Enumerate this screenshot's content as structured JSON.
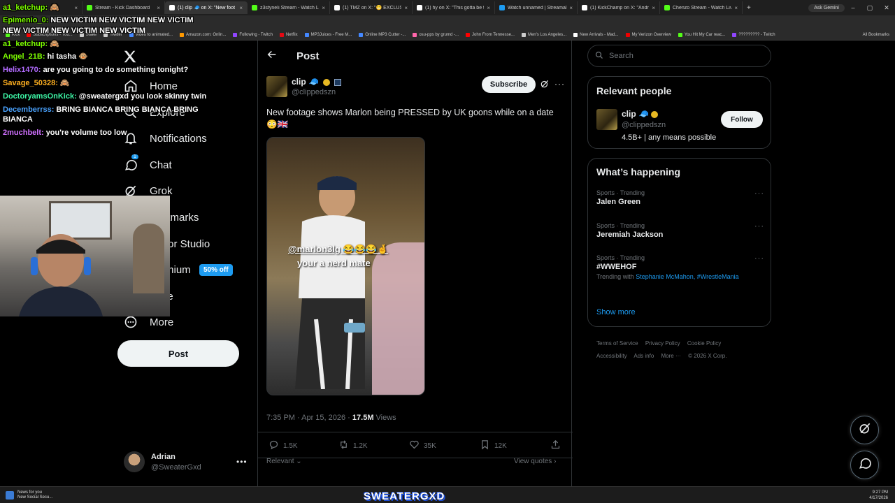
{
  "browser": {
    "tabs": [
      {
        "title": "",
        "color": "#a83232"
      },
      {
        "title": "Stream - Kick Dashboard",
        "color": "#53fc18"
      },
      {
        "title": "(1) clip 🧢 on X: \"New foot",
        "color": "#ffffff"
      },
      {
        "title": "z3styneIi Stream - Watch Live o",
        "color": "#53fc18"
      },
      {
        "title": "(1) TMZ on X: \"😬 EXCLUSIVE:",
        "color": "#ffffff"
      },
      {
        "title": "(1) hy on X: \"This gotta be the",
        "color": "#ffffff"
      },
      {
        "title": "Watch unnamed | Streamable",
        "color": "#1d9bf0"
      },
      {
        "title": "(1) KickChamp on X: \"Andr",
        "color": "#ffffff"
      },
      {
        "title": "Chenzo Stream - Watch Live on",
        "color": "#53fc18"
      }
    ],
    "active_tab": 2,
    "new_tab": "+",
    "ask_gemini": "Ask Gemini",
    "window_controls": [
      "–",
      "▢",
      "✕"
    ],
    "bookmarks": [
      {
        "label": "Kick",
        "color": "#53fc18"
      },
      {
        "label": "Subscriptions - You...",
        "color": "#ff0000"
      },
      {
        "label": "Stake",
        "color": "#cccccc"
      },
      {
        "label": "Twitter",
        "color": "#cccccc"
      },
      {
        "label": "Video to animated...",
        "color": "#4488ff"
      },
      {
        "label": "Amazon.com: Onlin...",
        "color": "#ff9900"
      },
      {
        "label": "Following - Twitch",
        "color": "#9146ff"
      },
      {
        "label": "Netflix",
        "color": "#e50914"
      },
      {
        "label": "MP3Juices - Free M...",
        "color": "#4488ff"
      },
      {
        "label": "Online MP3 Cutter -...",
        "color": "#4488ff"
      },
      {
        "label": "osu-pps by grumd -...",
        "color": "#ff66aa"
      },
      {
        "label": "John From Tennesse...",
        "color": "#ff0000"
      },
      {
        "label": "Men's Los Angeles...",
        "color": "#cccccc"
      },
      {
        "label": "New Arrivals - Mad...",
        "color": "#ffffff"
      },
      {
        "label": "My Verizon Overview",
        "color": "#ee0000"
      },
      {
        "label": "You Hit My Car reac...",
        "color": "#53fc18"
      },
      {
        "label": "????????? - Twitch",
        "color": "#9146ff"
      }
    ],
    "all_bookmarks": "All Bookmarks"
  },
  "sidebar": {
    "items": [
      {
        "label": "Home",
        "icon": "home-icon"
      },
      {
        "label": "Explore",
        "icon": "search-icon"
      },
      {
        "label": "Notifications",
        "icon": "bell-icon"
      },
      {
        "label": "Chat",
        "icon": "chat-icon",
        "badge": "1"
      },
      {
        "label": "Grok",
        "icon": "grok-icon"
      },
      {
        "label": "kmarks",
        "icon": "bookmark-icon"
      },
      {
        "label": "tor Studio",
        "icon": "studio-icon"
      },
      {
        "label": "mium",
        "icon": "premium-icon"
      },
      {
        "label": "le",
        "icon": "profile-icon"
      },
      {
        "label": "More",
        "icon": "more-circle-icon"
      }
    ],
    "premium_badge": "50% off",
    "post_button": "Post",
    "account": {
      "name": "Adrian",
      "handle": "@SweaterGxd",
      "more": "•••"
    }
  },
  "main": {
    "header_title": "Post",
    "author": {
      "name": "clip 🧢",
      "handle": "@clippedszn"
    },
    "subscribe_label": "Subscribe",
    "tweet_text_line1": "New footage shows Marlon being PRESSED by UK goons while on a date",
    "tweet_text_line2": "😳🇬🇧",
    "media_caption_1": "@marlon3lg 😂😂😂🤞",
    "media_caption_2": "your a nerd mate",
    "meta_time": "7:35 PM · Apr 15, 2026 · ",
    "meta_views_count": "17.5M",
    "meta_views_label": " Views",
    "actions": {
      "replies": "1.5K",
      "reposts": "1.2K",
      "likes": "35K",
      "bookmarks": "12K"
    },
    "sort_label": "Relevant",
    "view_quotes": "View quotes"
  },
  "right": {
    "search_placeholder": "Search",
    "relevant_title": "Relevant people",
    "relevant_person": {
      "name": "clip 🧢",
      "handle": "@clippedszn",
      "bio": "4.5B+ | any means possible"
    },
    "follow_label": "Follow",
    "happening_title": "What’s happening",
    "trends": [
      {
        "category": "Sports · Trending",
        "name": "Jalen Green"
      },
      {
        "category": "Sports · Trending",
        "name": "Jeremiah Jackson"
      },
      {
        "category": "Sports · Trending",
        "name": "#WWEHOF",
        "with_prefix": "Trending with ",
        "with_links": "Stephanie McMahon, #WrestleMania"
      }
    ],
    "show_more": "Show more",
    "footer": {
      "terms": "Terms of Service",
      "privacy": "Privacy Policy",
      "cookie": "Cookie Policy",
      "accessibility": "Accessibility",
      "ads": "Ads info",
      "more": "More ···",
      "copyright": "© 2026 X Corp."
    }
  },
  "chat": [
    {
      "user": "a1_ketchup:",
      "color": "#7cfc00",
      "text": "🙈"
    },
    {
      "user": "Epimenio_0:",
      "color": "#7cfc00",
      "text": "NEW VICTIM NEW VICTIM NEW VICTIM"
    },
    {
      "user": "",
      "color": "#ffffff",
      "text": "NEW VICTIM NEW VICTIM NEW VICTIM"
    },
    {
      "user": "a1_ketchup:",
      "color": "#7cfc00",
      "text": "🙈"
    },
    {
      "user": "Angel_21B:",
      "color": "#7cfc00",
      "text": "hi tasha 🐵"
    },
    {
      "user": "Helix1470:",
      "color": "#b26bff",
      "text": "are you going to do something tonight?"
    },
    {
      "user": "Savage_50328:",
      "color": "#ffb020",
      "text": "🙈"
    },
    {
      "user": "DoctoryamsOnKick:",
      "color": "#3df5a5",
      "text": "@sweatergxd you look skinny twin"
    },
    {
      "user": "Decemberrss:",
      "color": "#4aa3ff",
      "text": "BRING BIANCA BRING BIANCA BRING"
    },
    {
      "user": "",
      "color": "#ffffff",
      "text": "BIANCA"
    },
    {
      "user": "2muchbelt:",
      "color": "#d070ff",
      "text": "you're volume too low"
    }
  ],
  "stream_logo": "SWEATERGXD",
  "taskbar": {
    "news_title": "News for you",
    "news_sub": "New Social Secu...",
    "time": "9:27 PM",
    "date": "4/17/2026"
  }
}
